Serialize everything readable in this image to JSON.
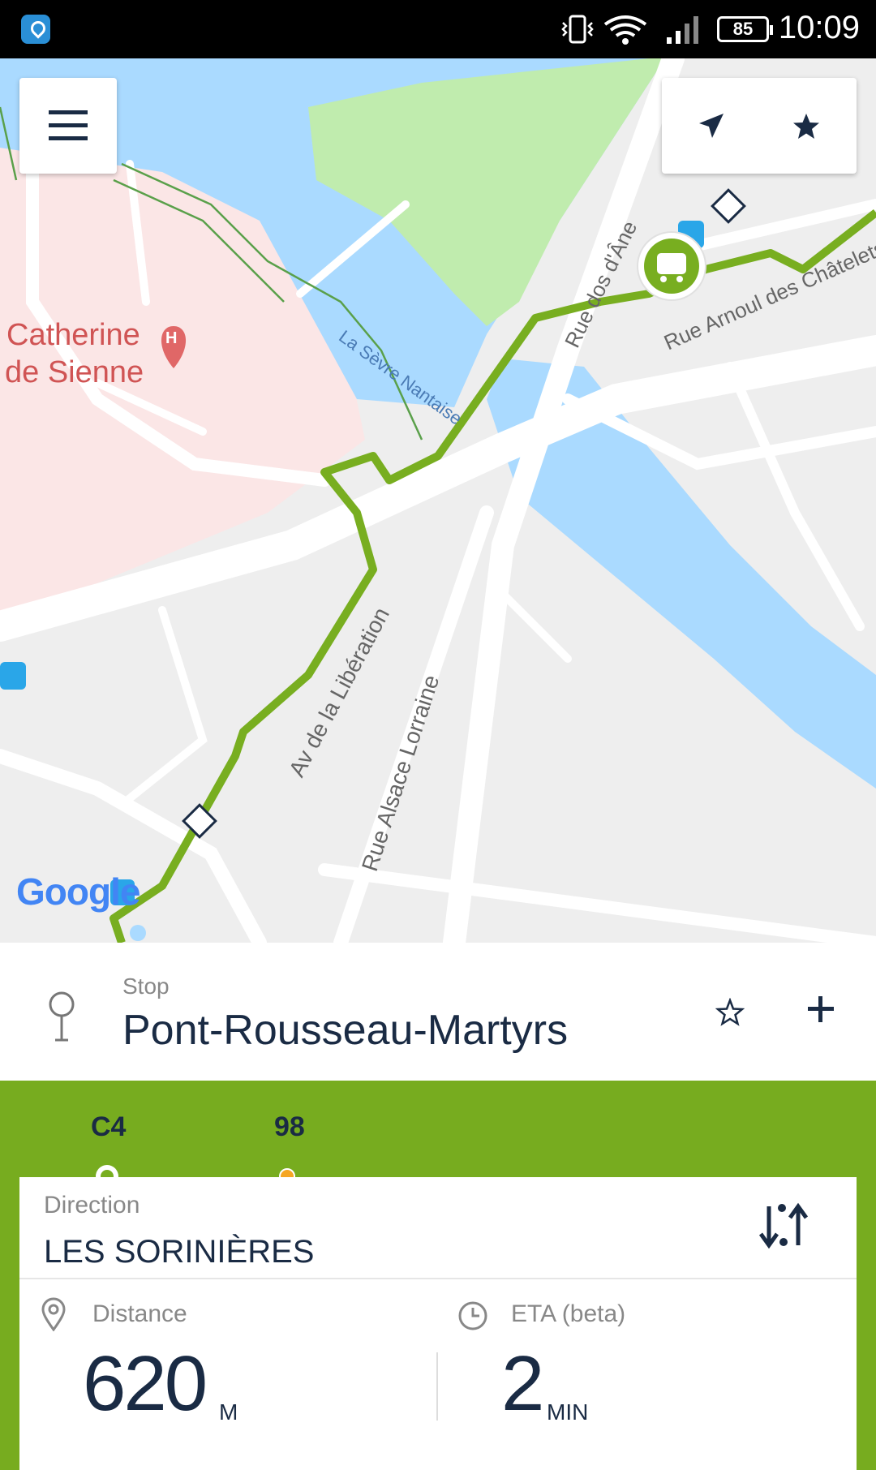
{
  "status_bar": {
    "time": "10:09",
    "battery": "85",
    "icons": [
      "location-app-icon",
      "vibrate-icon",
      "wifi-icon",
      "signal-icon",
      "battery-icon"
    ]
  },
  "map": {
    "labels": {
      "river": "La Sèvre Nantaise",
      "street_1": "Rue dos d'Âne",
      "street_2": "Av de la Libération",
      "street_3": "Rue Alsace Lorraine",
      "street_4": "Rue Arnoul des Châtelets",
      "poi_line1": "Catherine",
      "poi_line2": "de Sienne",
      "poi_marker": "H"
    },
    "google_logo": "Google",
    "colors": {
      "route": "#78ae20",
      "water": "#aadaff",
      "park": "#c0ecae",
      "hospital_area": "#fbe6e6",
      "poi_text": "#d05454"
    },
    "icons": [
      "menu-icon",
      "navigation-arrow-icon",
      "star-icon",
      "bus-stop-icon",
      "bus-icon",
      "diamond-marker-icon"
    ]
  },
  "stop": {
    "label": "Stop",
    "name": "Pont-Rousseau-Martyrs",
    "icons": [
      "pin-icon",
      "star-outline-icon",
      "plus-icon"
    ]
  },
  "lines": [
    {
      "name": "C4",
      "selected": true,
      "color": "#78ae20"
    },
    {
      "name": "98",
      "selected": false,
      "color": "#f5a623"
    }
  ],
  "direction": {
    "label": "Direction",
    "value": "LES SORINIÈRES"
  },
  "distance": {
    "label": "Distance",
    "value": "620",
    "unit": "M"
  },
  "eta": {
    "label": "ETA (beta)",
    "value": "2",
    "unit": "MIN"
  }
}
